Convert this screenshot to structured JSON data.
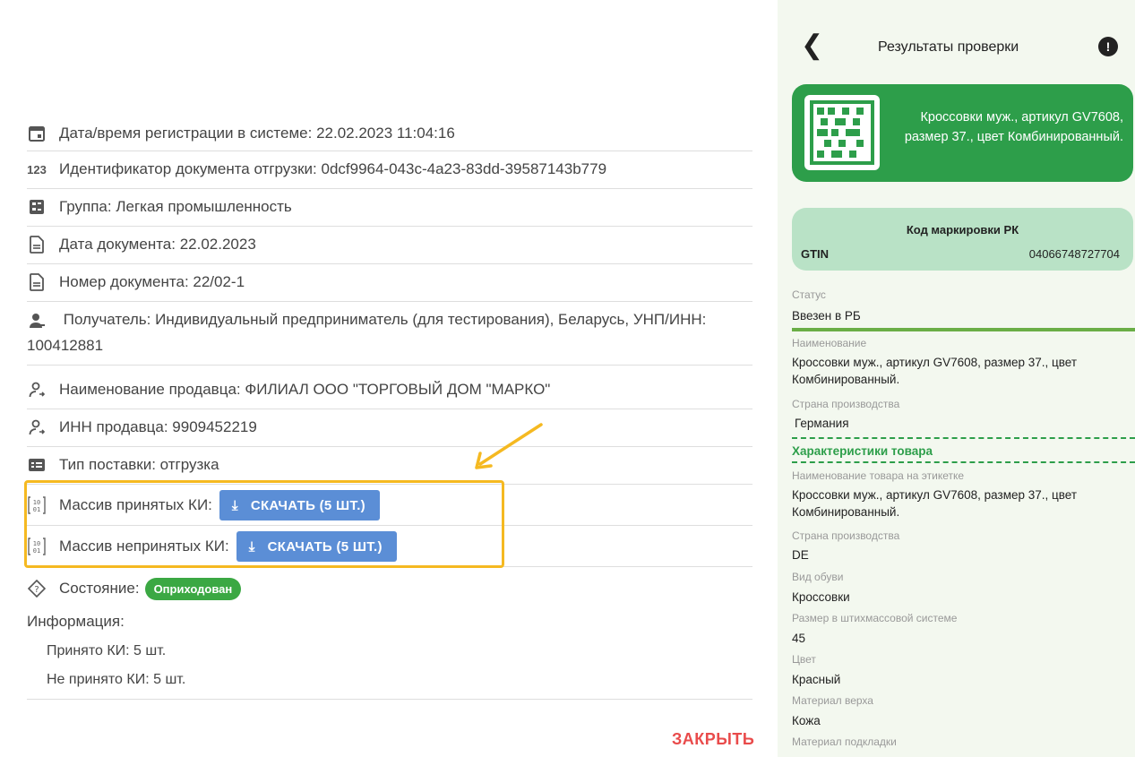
{
  "details": {
    "registration": "Дата/время регистрации в системе: 22.02.2023 11:04:16",
    "doc_id_icon": "123",
    "shipment_id": "Идентификатор документа отгрузки: 0dcf9964-043c-4a23-83dd-39587143b779",
    "group": "Группа: Легкая промышленность",
    "doc_date": "Дата документа: 22.02.2023",
    "doc_number": "Номер документа: 22/02-1",
    "recipient": "Получатель: Индивидуальный предприниматель (для тестирования), Беларусь, УНП/ИНН: 100412881",
    "seller_name": "Наименование продавца: ФИЛИАЛ ООО \"ТОРГОВЫЙ ДОМ \"МАРКО\"",
    "seller_inn": "ИНН продавца: 9909452219",
    "delivery_type": "Тип поставки: отгрузка",
    "accepted_label": "Массив принятых КИ:",
    "accepted_button": "СКАЧАТЬ (5 ШТ.)",
    "rejected_label": "Массив непринятых КИ:",
    "rejected_button": "СКАЧАТЬ (5 ШТ.)",
    "state_label": "Состояние:",
    "state_badge": "Оприходован"
  },
  "info": {
    "title": "Информация:",
    "accepted": "Принято КИ: 5 шт.",
    "rejected": "Не принято КИ: 5 шт."
  },
  "close_label": "ЗАКРЫТЬ",
  "result_panel": {
    "title": "Результаты проверки",
    "alert_icon_text": "!",
    "product_card_text": "Кроссовки муж., артикул GV7608, размер 37., цвет Комбинированный.",
    "code_title": "Код маркировки РК",
    "gtin_label": "GTIN",
    "gtin_value": "04066748727704",
    "fields": [
      {
        "label": "Статус",
        "value": "Ввезен в РБ"
      },
      {
        "label": "Наименование",
        "value": "Кроссовки муж., артикул GV7608, размер 37., цвет Комбинированный."
      },
      {
        "label": "Страна производства",
        "value": "Германия"
      }
    ],
    "section_title": "Характеристики товара",
    "characteristics": [
      {
        "label": "Наименование товара на этикетке",
        "value": "Кроссовки муж., артикул GV7608, размер 37., цвет Комбинированный."
      },
      {
        "label": "Страна производства",
        "value": "DE"
      },
      {
        "label": "Вид обуви",
        "value": "Кроссовки"
      },
      {
        "label": "Размер в штихмассовой системе",
        "value": "45"
      },
      {
        "label": "Цвет",
        "value": "Красный"
      },
      {
        "label": "Материал верха",
        "value": "Кожа"
      },
      {
        "label": "Материал подкладки",
        "value": ""
      }
    ]
  },
  "colors": {
    "accent_green": "#2d9e4a",
    "button_blue": "#5b8ed6",
    "highlight_yellow": "#f5b921",
    "close_red": "#e94b4b"
  }
}
